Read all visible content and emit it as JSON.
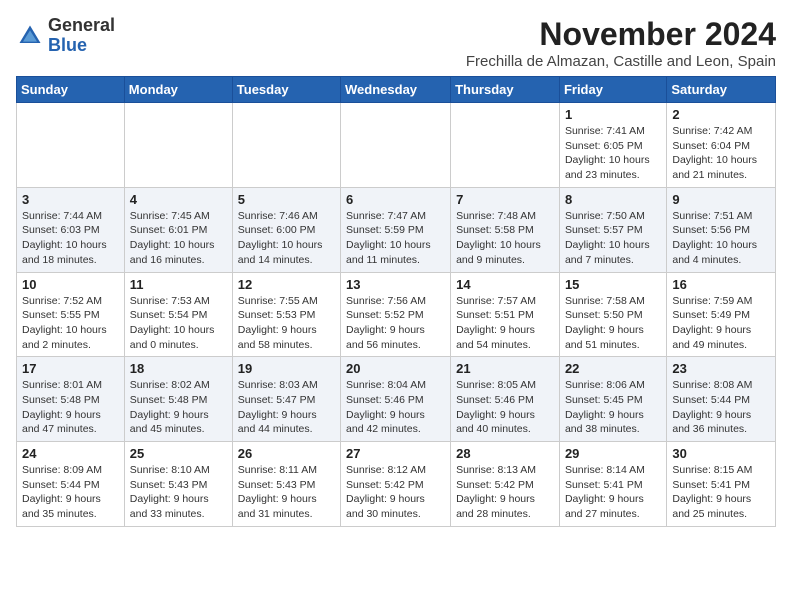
{
  "logo": {
    "general": "General",
    "blue": "Blue"
  },
  "header": {
    "month": "November 2024",
    "location": "Frechilla de Almazan, Castille and Leon, Spain"
  },
  "weekdays": [
    "Sunday",
    "Monday",
    "Tuesday",
    "Wednesday",
    "Thursday",
    "Friday",
    "Saturday"
  ],
  "weeks": [
    [
      {
        "day": "",
        "info": ""
      },
      {
        "day": "",
        "info": ""
      },
      {
        "day": "",
        "info": ""
      },
      {
        "day": "",
        "info": ""
      },
      {
        "day": "",
        "info": ""
      },
      {
        "day": "1",
        "info": "Sunrise: 7:41 AM\nSunset: 6:05 PM\nDaylight: 10 hours and 23 minutes."
      },
      {
        "day": "2",
        "info": "Sunrise: 7:42 AM\nSunset: 6:04 PM\nDaylight: 10 hours and 21 minutes."
      }
    ],
    [
      {
        "day": "3",
        "info": "Sunrise: 7:44 AM\nSunset: 6:03 PM\nDaylight: 10 hours and 18 minutes."
      },
      {
        "day": "4",
        "info": "Sunrise: 7:45 AM\nSunset: 6:01 PM\nDaylight: 10 hours and 16 minutes."
      },
      {
        "day": "5",
        "info": "Sunrise: 7:46 AM\nSunset: 6:00 PM\nDaylight: 10 hours and 14 minutes."
      },
      {
        "day": "6",
        "info": "Sunrise: 7:47 AM\nSunset: 5:59 PM\nDaylight: 10 hours and 11 minutes."
      },
      {
        "day": "7",
        "info": "Sunrise: 7:48 AM\nSunset: 5:58 PM\nDaylight: 10 hours and 9 minutes."
      },
      {
        "day": "8",
        "info": "Sunrise: 7:50 AM\nSunset: 5:57 PM\nDaylight: 10 hours and 7 minutes."
      },
      {
        "day": "9",
        "info": "Sunrise: 7:51 AM\nSunset: 5:56 PM\nDaylight: 10 hours and 4 minutes."
      }
    ],
    [
      {
        "day": "10",
        "info": "Sunrise: 7:52 AM\nSunset: 5:55 PM\nDaylight: 10 hours and 2 minutes."
      },
      {
        "day": "11",
        "info": "Sunrise: 7:53 AM\nSunset: 5:54 PM\nDaylight: 10 hours and 0 minutes."
      },
      {
        "day": "12",
        "info": "Sunrise: 7:55 AM\nSunset: 5:53 PM\nDaylight: 9 hours and 58 minutes."
      },
      {
        "day": "13",
        "info": "Sunrise: 7:56 AM\nSunset: 5:52 PM\nDaylight: 9 hours and 56 minutes."
      },
      {
        "day": "14",
        "info": "Sunrise: 7:57 AM\nSunset: 5:51 PM\nDaylight: 9 hours and 54 minutes."
      },
      {
        "day": "15",
        "info": "Sunrise: 7:58 AM\nSunset: 5:50 PM\nDaylight: 9 hours and 51 minutes."
      },
      {
        "day": "16",
        "info": "Sunrise: 7:59 AM\nSunset: 5:49 PM\nDaylight: 9 hours and 49 minutes."
      }
    ],
    [
      {
        "day": "17",
        "info": "Sunrise: 8:01 AM\nSunset: 5:48 PM\nDaylight: 9 hours and 47 minutes."
      },
      {
        "day": "18",
        "info": "Sunrise: 8:02 AM\nSunset: 5:48 PM\nDaylight: 9 hours and 45 minutes."
      },
      {
        "day": "19",
        "info": "Sunrise: 8:03 AM\nSunset: 5:47 PM\nDaylight: 9 hours and 44 minutes."
      },
      {
        "day": "20",
        "info": "Sunrise: 8:04 AM\nSunset: 5:46 PM\nDaylight: 9 hours and 42 minutes."
      },
      {
        "day": "21",
        "info": "Sunrise: 8:05 AM\nSunset: 5:46 PM\nDaylight: 9 hours and 40 minutes."
      },
      {
        "day": "22",
        "info": "Sunrise: 8:06 AM\nSunset: 5:45 PM\nDaylight: 9 hours and 38 minutes."
      },
      {
        "day": "23",
        "info": "Sunrise: 8:08 AM\nSunset: 5:44 PM\nDaylight: 9 hours and 36 minutes."
      }
    ],
    [
      {
        "day": "24",
        "info": "Sunrise: 8:09 AM\nSunset: 5:44 PM\nDaylight: 9 hours and 35 minutes."
      },
      {
        "day": "25",
        "info": "Sunrise: 8:10 AM\nSunset: 5:43 PM\nDaylight: 9 hours and 33 minutes."
      },
      {
        "day": "26",
        "info": "Sunrise: 8:11 AM\nSunset: 5:43 PM\nDaylight: 9 hours and 31 minutes."
      },
      {
        "day": "27",
        "info": "Sunrise: 8:12 AM\nSunset: 5:42 PM\nDaylight: 9 hours and 30 minutes."
      },
      {
        "day": "28",
        "info": "Sunrise: 8:13 AM\nSunset: 5:42 PM\nDaylight: 9 hours and 28 minutes."
      },
      {
        "day": "29",
        "info": "Sunrise: 8:14 AM\nSunset: 5:41 PM\nDaylight: 9 hours and 27 minutes."
      },
      {
        "day": "30",
        "info": "Sunrise: 8:15 AM\nSunset: 5:41 PM\nDaylight: 9 hours and 25 minutes."
      }
    ]
  ]
}
